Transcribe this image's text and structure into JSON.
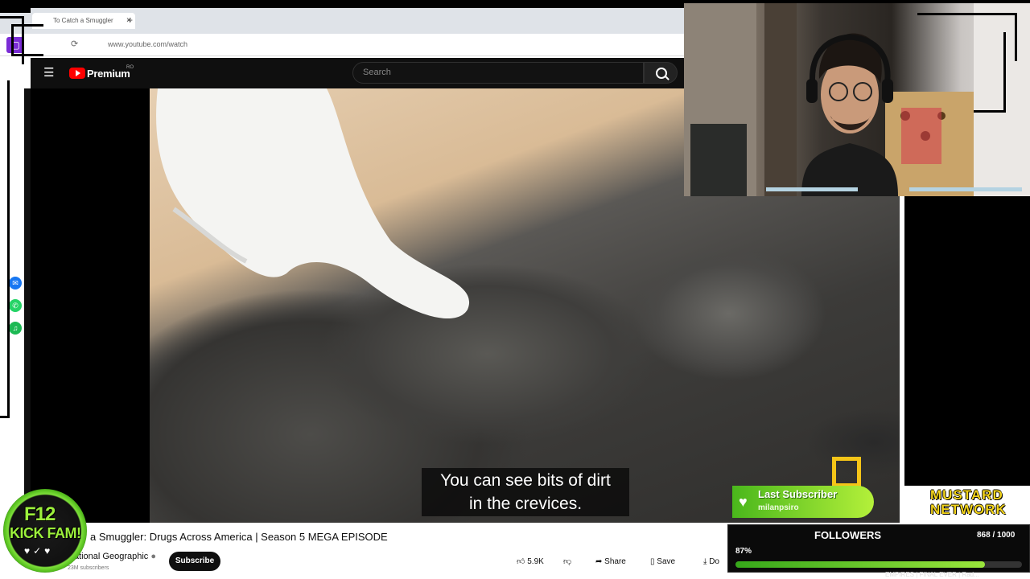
{
  "browser": {
    "tab_title": "To Catch a Smuggler",
    "new_tab": "+",
    "url": "www.youtube.com/watch"
  },
  "youtube": {
    "brand": "Premium",
    "region": "RO",
    "search_placeholder": "Search"
  },
  "video": {
    "subtitle_line1": "You can see bits of dirt",
    "subtitle_line2": "in the crevices.",
    "title": "a Smuggler: Drugs Across America | Season 5 MEGA EPISODE",
    "channel": "National Geographic",
    "subscribers": "23M subscribers",
    "subscribe_label": "Subscribe",
    "likes": "5.9K",
    "share_label": "Share",
    "save_label": "Save",
    "download_label": "Do"
  },
  "overlay": {
    "kick_line1": "F12",
    "kick_line2": "KICK FAM!",
    "last_sub_label": "Last Subscriber",
    "last_sub_name": "milanpsiro",
    "brand_line1": "MUSTARD",
    "brand_line2": "NETWORK",
    "followers_label": "FOLLOWERS",
    "followers_count": "868 / 1000",
    "followers_pct": "87%",
    "followers_fraction": 0.87,
    "ticker": "EMPIRES | FINAL EVER | Rad..."
  },
  "colors": {
    "accent_green": "#7ee03a",
    "brand_yellow": "#f2d31b",
    "youtube_red": "#ff0000"
  }
}
